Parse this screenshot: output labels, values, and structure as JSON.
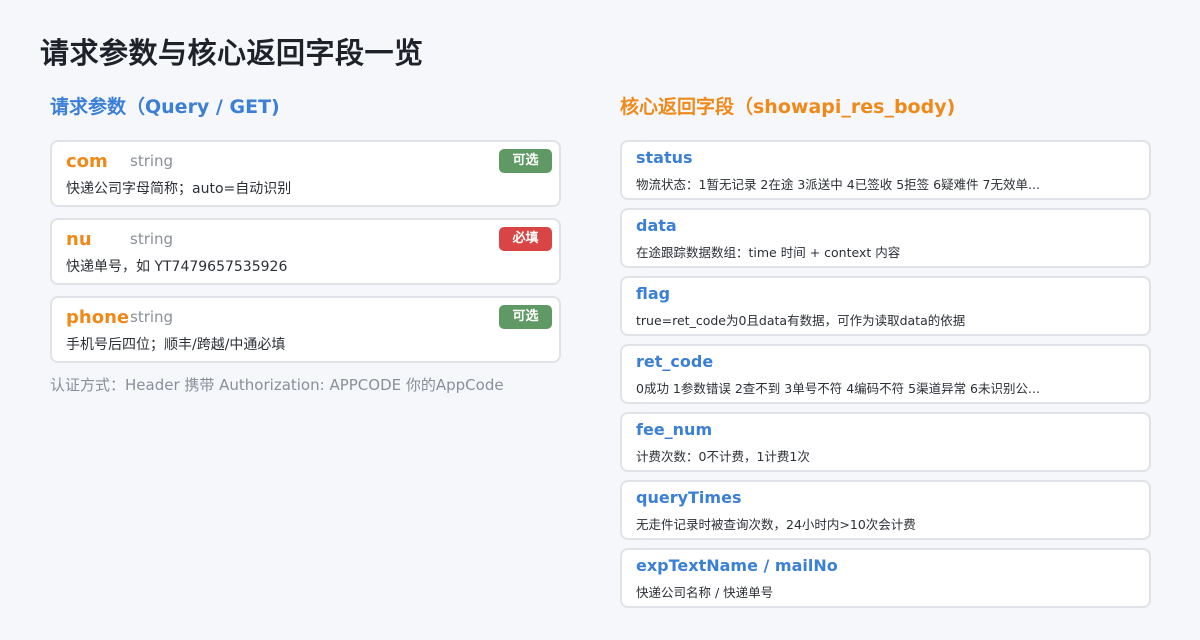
{
  "page_title": "请求参数与核心返回字段一览",
  "request": {
    "title": "请求参数（Query / GET)",
    "params": [
      {
        "name": "com",
        "type": "string",
        "badge": "可选",
        "badge_kind": "optional",
        "desc": "快递公司字母简称；auto=自动识别"
      },
      {
        "name": "nu",
        "type": "string",
        "badge": "必填",
        "badge_kind": "required",
        "desc": "快递单号，如 YT7479657535926"
      },
      {
        "name": "phone",
        "type": "string",
        "badge": "可选",
        "badge_kind": "optional",
        "desc": "手机号后四位；顺丰/跨越/中通必填"
      }
    ],
    "auth_note": "认证方式：Header 携带 Authorization: APPCODE 你的AppCode"
  },
  "response": {
    "title": "核心返回字段（showapi_res_body)",
    "fields": [
      {
        "name": "status",
        "desc": "物流状态：1暂无记录 2在途 3派送中 4已签收 5拒签 6疑难件 7无效单..."
      },
      {
        "name": "data",
        "desc": "在途跟踪数据数组：time 时间 + context 内容"
      },
      {
        "name": "flag",
        "desc": "true=ret_code为0且data有数据，可作为读取data的依据"
      },
      {
        "name": "ret_code",
        "desc": "0成功 1参数错误 2查不到 3单号不符 4编码不符 5渠道异常 6未识别公..."
      },
      {
        "name": "fee_num",
        "desc": "计费次数：0不计费，1计费1次"
      },
      {
        "name": "queryTimes",
        "desc": "无走件记录时被查询次数，24小时内>10次会计费"
      },
      {
        "name": "expTextName / mailNo",
        "desc": "快递公司名称 / 快递单号"
      }
    ]
  },
  "colors": {
    "accent_blue": "#3b7fd6",
    "accent_orange": "#ef8a1a",
    "badge_optional": "#5f9a64",
    "badge_required": "#d94444"
  }
}
